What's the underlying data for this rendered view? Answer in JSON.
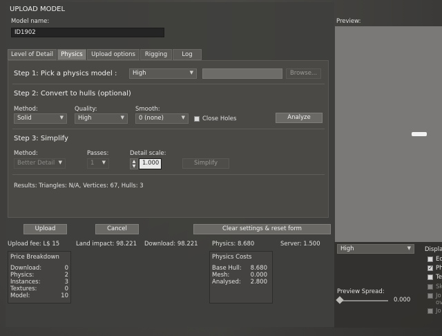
{
  "window": {
    "title": "UPLOAD MODEL"
  },
  "model_name": {
    "label": "Model name:",
    "value": "ID1902"
  },
  "tabs": [
    {
      "label": "Level of Detail"
    },
    {
      "label": "Physics"
    },
    {
      "label": "Upload options"
    },
    {
      "label": "Rigging"
    },
    {
      "label": "Log"
    }
  ],
  "step1": {
    "title": "Step 1: Pick a physics model :",
    "model_value": "High",
    "browse_label": "Browse..."
  },
  "step2": {
    "title": "Step 2: Convert to hulls (optional)",
    "method_label": "Method:",
    "method_value": "Solid",
    "quality_label": "Quality:",
    "quality_value": "High",
    "smooth_label": "Smooth:",
    "smooth_value": "0 (none)",
    "close_holes_label": "Close Holes",
    "analyze_label": "Analyze"
  },
  "step3": {
    "title": "Step 3: Simplify",
    "method_label": "Method:",
    "method_value": "Better Detail",
    "passes_label": "Passes:",
    "passes_value": "1",
    "detail_label": "Detail scale:",
    "detail_value": "1.000",
    "simplify_label": "Simplify"
  },
  "results": "Results:  Triangles: N/A,  Vertices: 67,    Hulls: 3",
  "buttons": {
    "upload": "Upload",
    "cancel": "Cancel",
    "clear": "Clear settings & reset form"
  },
  "fees": {
    "upload_fee": "Upload fee: L$ 15",
    "land_impact": "Land impact: 98.221",
    "download": "Download: 98.221",
    "physics": "Physics: 8.680",
    "server": "Server: 1.500"
  },
  "price_breakdown": {
    "title": "Price Breakdown",
    "rows": [
      {
        "label": "Download:",
        "value": "0"
      },
      {
        "label": "Physics:",
        "value": "2"
      },
      {
        "label": "Instances:",
        "value": "3"
      },
      {
        "label": "Textures:",
        "value": "0"
      },
      {
        "label": "Model:",
        "value": "10"
      }
    ]
  },
  "physics_costs": {
    "title": "Physics Costs",
    "rows": [
      {
        "label": "Base Hull:",
        "value": "8.680"
      },
      {
        "label": "Mesh:",
        "value": "0.000"
      },
      {
        "label": "Analysed:",
        "value": "2.800"
      }
    ]
  },
  "preview": {
    "label": "Preview:",
    "lod_value": "High",
    "display_label": "Displa",
    "spread_label": "Preview Spread:",
    "spread_value": "0.000",
    "display_options": [
      {
        "label": "Ed",
        "checked": false,
        "disabled": false
      },
      {
        "label": "Ph",
        "checked": true,
        "disabled": false
      },
      {
        "label": "Te",
        "checked": false,
        "disabled": false
      },
      {
        "label": "Sk",
        "checked": false,
        "disabled": true
      },
      {
        "label": "Jo",
        "checked": false,
        "disabled": true
      },
      {
        "label": "ov",
        "checked": false,
        "disabled": true
      },
      {
        "label": "Jo",
        "checked": false,
        "disabled": true
      }
    ]
  }
}
